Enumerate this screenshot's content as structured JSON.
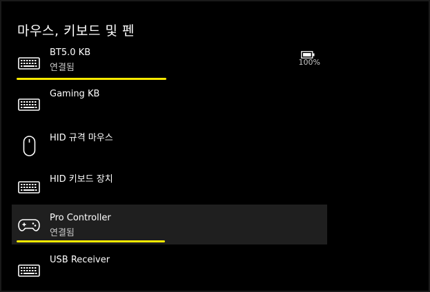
{
  "section": {
    "title": "마우스, 키보드 및 펜"
  },
  "colors": {
    "background": "#000000",
    "selected_row": "#1f1f1f",
    "highlight": "#ffeb00",
    "text": "#ffffff",
    "secondary_text": "#c8c8c8"
  },
  "devices": [
    {
      "name": "BT5.0 KB",
      "status": "연결됨",
      "icon": "keyboard-icon",
      "battery": "100%",
      "highlighted": true
    },
    {
      "name": "Gaming KB",
      "status": "",
      "icon": "keyboard-icon"
    },
    {
      "name": "HID 규격 마우스",
      "status": "",
      "icon": "mouse-icon"
    },
    {
      "name": "HID 키보드 장치",
      "status": "",
      "icon": "keyboard-icon"
    },
    {
      "name": "Pro Controller",
      "status": "연결됨",
      "icon": "gamepad-icon",
      "selected": true,
      "highlighted": true
    },
    {
      "name": "USB Receiver",
      "status": "",
      "icon": "keyboard-icon"
    }
  ]
}
